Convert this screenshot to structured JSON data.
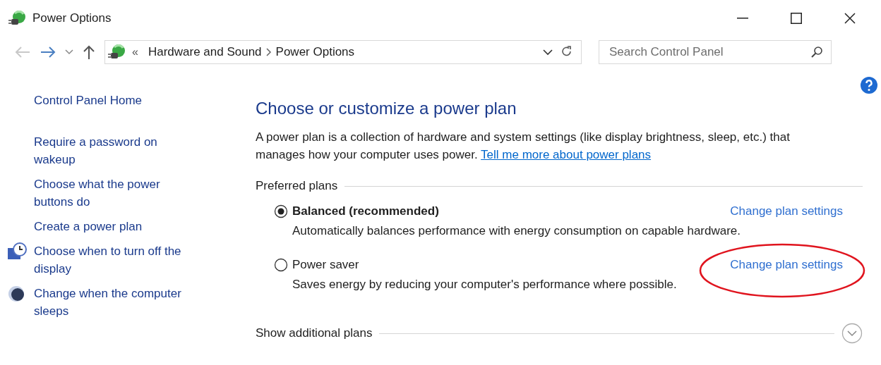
{
  "window": {
    "title": "Power Options"
  },
  "address_bar": {
    "overflow": "«",
    "breadcrumbs": [
      "Hardware and Sound",
      "Power Options"
    ]
  },
  "search": {
    "placeholder": "Search Control Panel"
  },
  "sidebar": {
    "items": [
      {
        "label": "Control Panel Home",
        "kind": "home"
      },
      {
        "label": "Require a password on wakeup",
        "kind": "plain"
      },
      {
        "label": "Choose what the power buttons do",
        "kind": "plain"
      },
      {
        "label": "Create a power plan",
        "kind": "plain"
      },
      {
        "label": "Choose when to turn off the display",
        "kind": "display"
      },
      {
        "label": "Change when the computer sleeps",
        "kind": "sleep"
      }
    ]
  },
  "main": {
    "heading": "Choose or customize a power plan",
    "description": "A power plan is a collection of hardware and system settings (like display brightness, sleep, etc.) that manages how your computer uses power.",
    "link": "Tell me more about power plans",
    "preferred_plans": {
      "label": "Preferred plans",
      "plans": [
        {
          "name": "Balanced (recommended)",
          "selected": true,
          "description": "Automatically balances performance with energy consumption on capable hardware.",
          "link": "Change plan settings",
          "circled": false
        },
        {
          "name": "Power saver",
          "selected": false,
          "description": "Saves energy by reducing your computer's performance where possible.",
          "link": "Change plan settings",
          "circled": true
        }
      ]
    },
    "additional_plans": {
      "label": "Show additional plans",
      "expanded": false
    }
  }
}
